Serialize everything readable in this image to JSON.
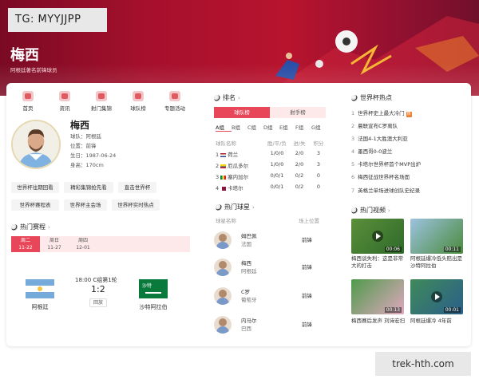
{
  "tg_label": "TG: MYYJJPP",
  "header": {
    "title": "梅西",
    "subtitle": "阿根廷著名前锋球员"
  },
  "top_icons": [
    "首页",
    "资讯",
    "射门集锦",
    "球队榜",
    "专题活动"
  ],
  "player": {
    "name": "梅西",
    "info": [
      "球队：阿根廷",
      "位置：前锋",
      "生日：1987-06-24",
      "身高：170cm"
    ]
  },
  "tags": [
    "世界杯往期回看",
    "精彩集锦抢先看",
    "直击世界杯",
    "世界杯赛程表",
    "世界杯主会场",
    "世界杯实时热点"
  ],
  "schedule": {
    "title": "热门赛程",
    "dates": [
      {
        "day": "周二",
        "date": "11-22"
      },
      {
        "day": "周日",
        "date": "11-27"
      },
      {
        "day": "周四",
        "date": "12-01"
      }
    ],
    "match": {
      "time": "18:00",
      "group": "C组第1轮",
      "score": "1:2",
      "replay": "回放",
      "home": "阿根廷",
      "away": "沙特阿拉伯",
      "away_flag_text": "沙特"
    }
  },
  "ranking": {
    "title": "排名",
    "tabs": [
      "球队榜",
      "射手榜"
    ],
    "groups": [
      "A组",
      "B组",
      "C组",
      "D组",
      "E组",
      "F组",
      "G组"
    ],
    "headers": [
      "球队名称",
      "胜/平/负",
      "进/失",
      "积分"
    ],
    "rows": [
      {
        "rank": "1",
        "team": "荷兰",
        "wdl": "1/0/0",
        "gf": "2/0",
        "pts": "3"
      },
      {
        "rank": "2",
        "team": "厄瓜多尔",
        "wdl": "1/0/0",
        "gf": "2/0",
        "pts": "3"
      },
      {
        "rank": "3",
        "team": "塞内加尔",
        "wdl": "0/0/1",
        "gf": "0/2",
        "pts": "0"
      },
      {
        "rank": "4",
        "team": "卡塔尔",
        "wdl": "0/0/1",
        "gf": "0/2",
        "pts": "0"
      }
    ]
  },
  "hot_players": {
    "title": "热门球星",
    "headers": [
      "球星名称",
      "场上位置"
    ],
    "rows": [
      {
        "name": "姆巴佩",
        "country": "法国",
        "pos": "前锋"
      },
      {
        "name": "梅西",
        "country": "阿根廷",
        "pos": "前锋"
      },
      {
        "name": "C罗",
        "country": "葡萄牙",
        "pos": "前锋"
      },
      {
        "name": "内马尔",
        "country": "巴西",
        "pos": "前锋"
      }
    ]
  },
  "hot_topics": {
    "title": "世界杯热点",
    "items": [
      {
        "n": "1",
        "text": "世界杯史上最大冷门",
        "badge": "热"
      },
      {
        "n": "2",
        "text": "晨联宣布C罗离队"
      },
      {
        "n": "3",
        "text": "法国4-1大胜澳大利亚"
      },
      {
        "n": "4",
        "text": "墨西哥0-0波兰"
      },
      {
        "n": "5",
        "text": "卡塔尔世界杯首个MVP出炉"
      },
      {
        "n": "6",
        "text": "梅西征战世界杯名场面"
      },
      {
        "n": "7",
        "text": "英格兰单场进球创队史纪录"
      }
    ]
  },
  "hot_videos": {
    "title": "热门视频",
    "items": [
      {
        "dur": "00:06",
        "title": "梅西谈失利：这是非常大的打击"
      },
      {
        "dur": "00:11",
        "title": "阿根廷爆冷低头赔出是沙特阿拉伯"
      },
      {
        "dur": "00:13",
        "title": "梅西赛后发声 刘诗宏扫"
      },
      {
        "dur": "00:01",
        "title": "阿根廷爆冷 4年前"
      }
    ]
  },
  "watermark": "trek-hth.com"
}
